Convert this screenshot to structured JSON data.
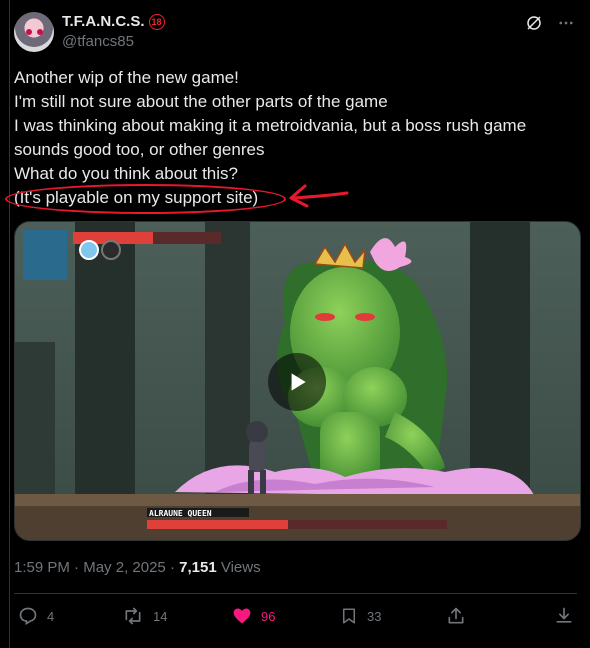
{
  "author": {
    "display_name": "T.F.A.N.C.S.",
    "age_badge": "18",
    "handle": "@tfancs85"
  },
  "tweet": {
    "lines": [
      "Another wip of the new game!",
      "I'm still not sure about the other parts of the game",
      "I was thinking about making it a metroidvania, but a boss rush game",
      "sounds good too, or other genres",
      "What do you think about this?",
      "(It's playable on my support site)"
    ]
  },
  "video": {
    "boss_name": "ALRAUNE QUEEN",
    "player_health": 0.55,
    "boss_health": 0.47
  },
  "meta": {
    "time": "1:59 PM",
    "separator": "·",
    "date": "May 2, 2025",
    "views_count": "7,151",
    "views_label": "Views"
  },
  "actions": {
    "replies": "4",
    "reposts": "14",
    "likes": "96",
    "bookmarks": "33"
  },
  "colors": {
    "like_active": "#f91880",
    "annotation_red": "#e8192c",
    "muted": "#71767b",
    "text": "#e7e9ea"
  }
}
